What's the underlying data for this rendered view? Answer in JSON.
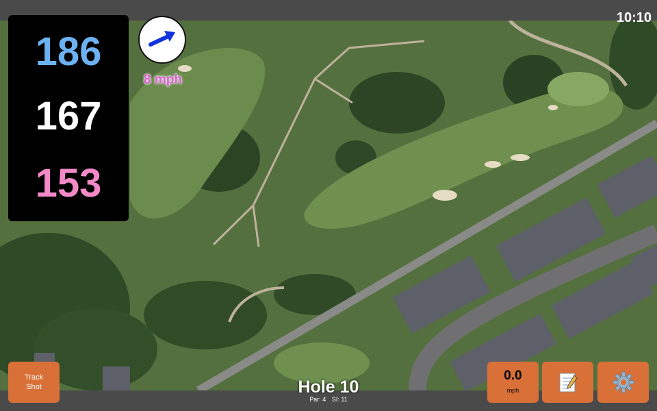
{
  "clock": "10:10",
  "distances": {
    "back": "186",
    "middle": "167",
    "front": "153"
  },
  "colors": {
    "back": "#6cb2f2",
    "middle": "#ffffff",
    "front": "#f38ac7",
    "wind_label": "#e05fd6",
    "button": "#d97038"
  },
  "wind": {
    "speed_label": "8 mph",
    "direction_icon": "arrow-icon"
  },
  "hole": {
    "title": "Hole 10",
    "par": "Par: 4",
    "si": "SI: 11"
  },
  "buttons": {
    "track_line1": "Track",
    "track_line2": "Shot",
    "speed_value": "0.0",
    "speed_unit": "mph",
    "notes_icon": "notepad-icon",
    "settings_icon": "gear-icon"
  },
  "map": {
    "type": "satellite",
    "icon": "aerial-golf-hole-map"
  }
}
